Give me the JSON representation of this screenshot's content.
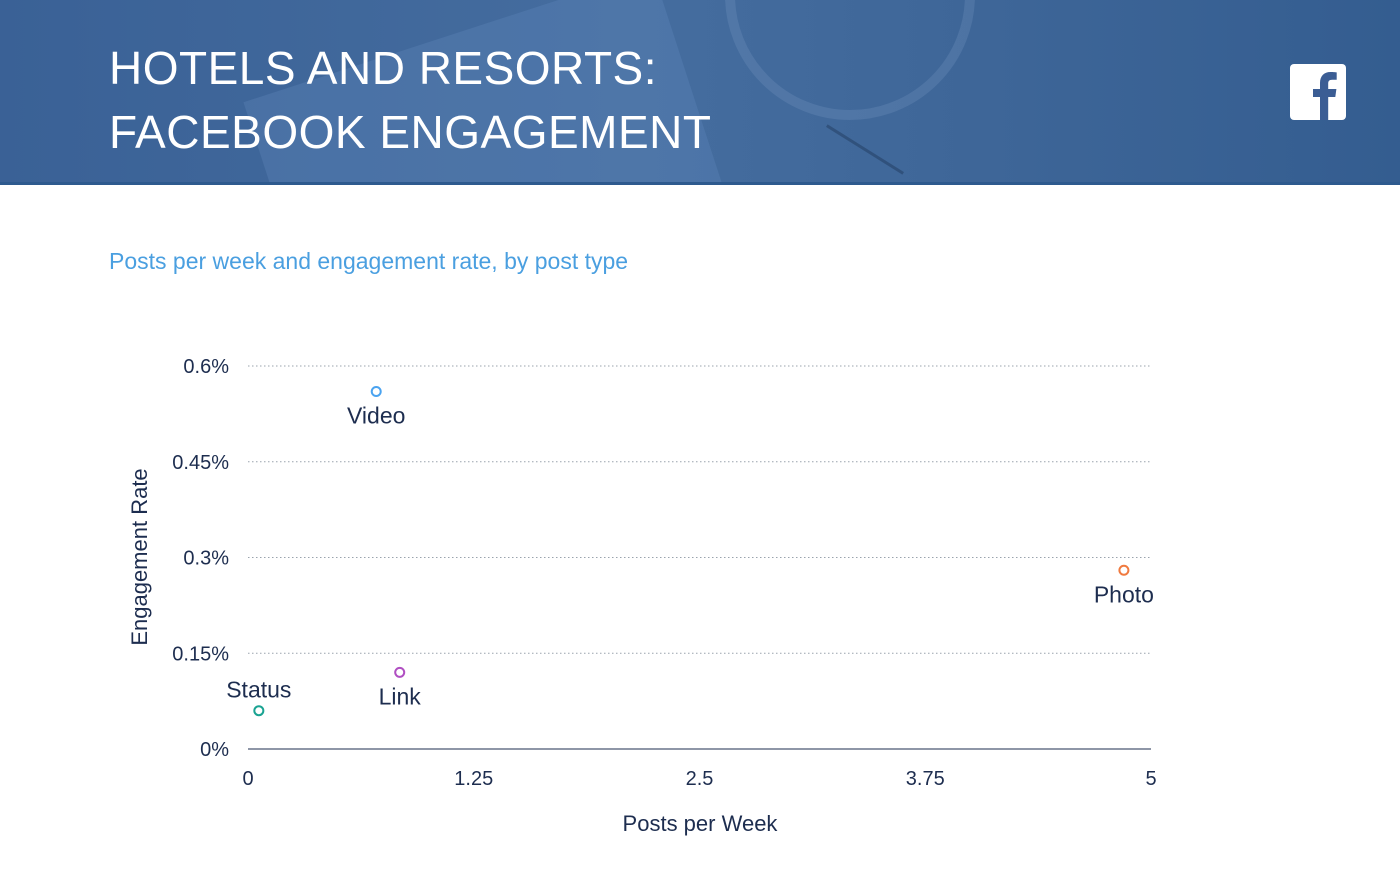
{
  "header": {
    "title_line1": "HOTELS AND RESORTS:",
    "title_line2": "FACEBOOK ENGAGEMENT",
    "logo_icon": "facebook-icon",
    "background_color": "#3e6698"
  },
  "chart_data": {
    "type": "scatter",
    "title": "HOTELS AND RESORTS: FACEBOOK ENGAGEMENT",
    "subtitle": "Posts per week and engagement rate, by post type",
    "xlabel": "Posts per Week",
    "ylabel": "Engagement Rate",
    "xlim": [
      0,
      5
    ],
    "ylim": [
      0,
      0.6
    ],
    "xticks": [
      {
        "value": 0,
        "label": "0"
      },
      {
        "value": 1.25,
        "label": "1.25"
      },
      {
        "value": 2.5,
        "label": "2.5"
      },
      {
        "value": 3.75,
        "label": "3.75"
      },
      {
        "value": 5,
        "label": "5"
      }
    ],
    "yticks": [
      {
        "value": 0,
        "label": "0%"
      },
      {
        "value": 0.15,
        "label": "0.15%"
      },
      {
        "value": 0.3,
        "label": "0.3%"
      },
      {
        "value": 0.45,
        "label": "0.45%"
      },
      {
        "value": 0.6,
        "label": "0.6%"
      }
    ],
    "grid": true,
    "legend": "none",
    "points": [
      {
        "label": "Video",
        "x": 0.71,
        "y": 0.56,
        "color": "#4aa3f0",
        "label_position": "below"
      },
      {
        "label": "Photo",
        "x": 4.85,
        "y": 0.28,
        "color": "#f07a3f",
        "label_position": "below"
      },
      {
        "label": "Link",
        "x": 0.84,
        "y": 0.12,
        "color": "#b04fc2",
        "label_position": "below"
      },
      {
        "label": "Status",
        "x": 0.06,
        "y": 0.06,
        "color": "#1aa392",
        "label_position": "above"
      }
    ]
  }
}
